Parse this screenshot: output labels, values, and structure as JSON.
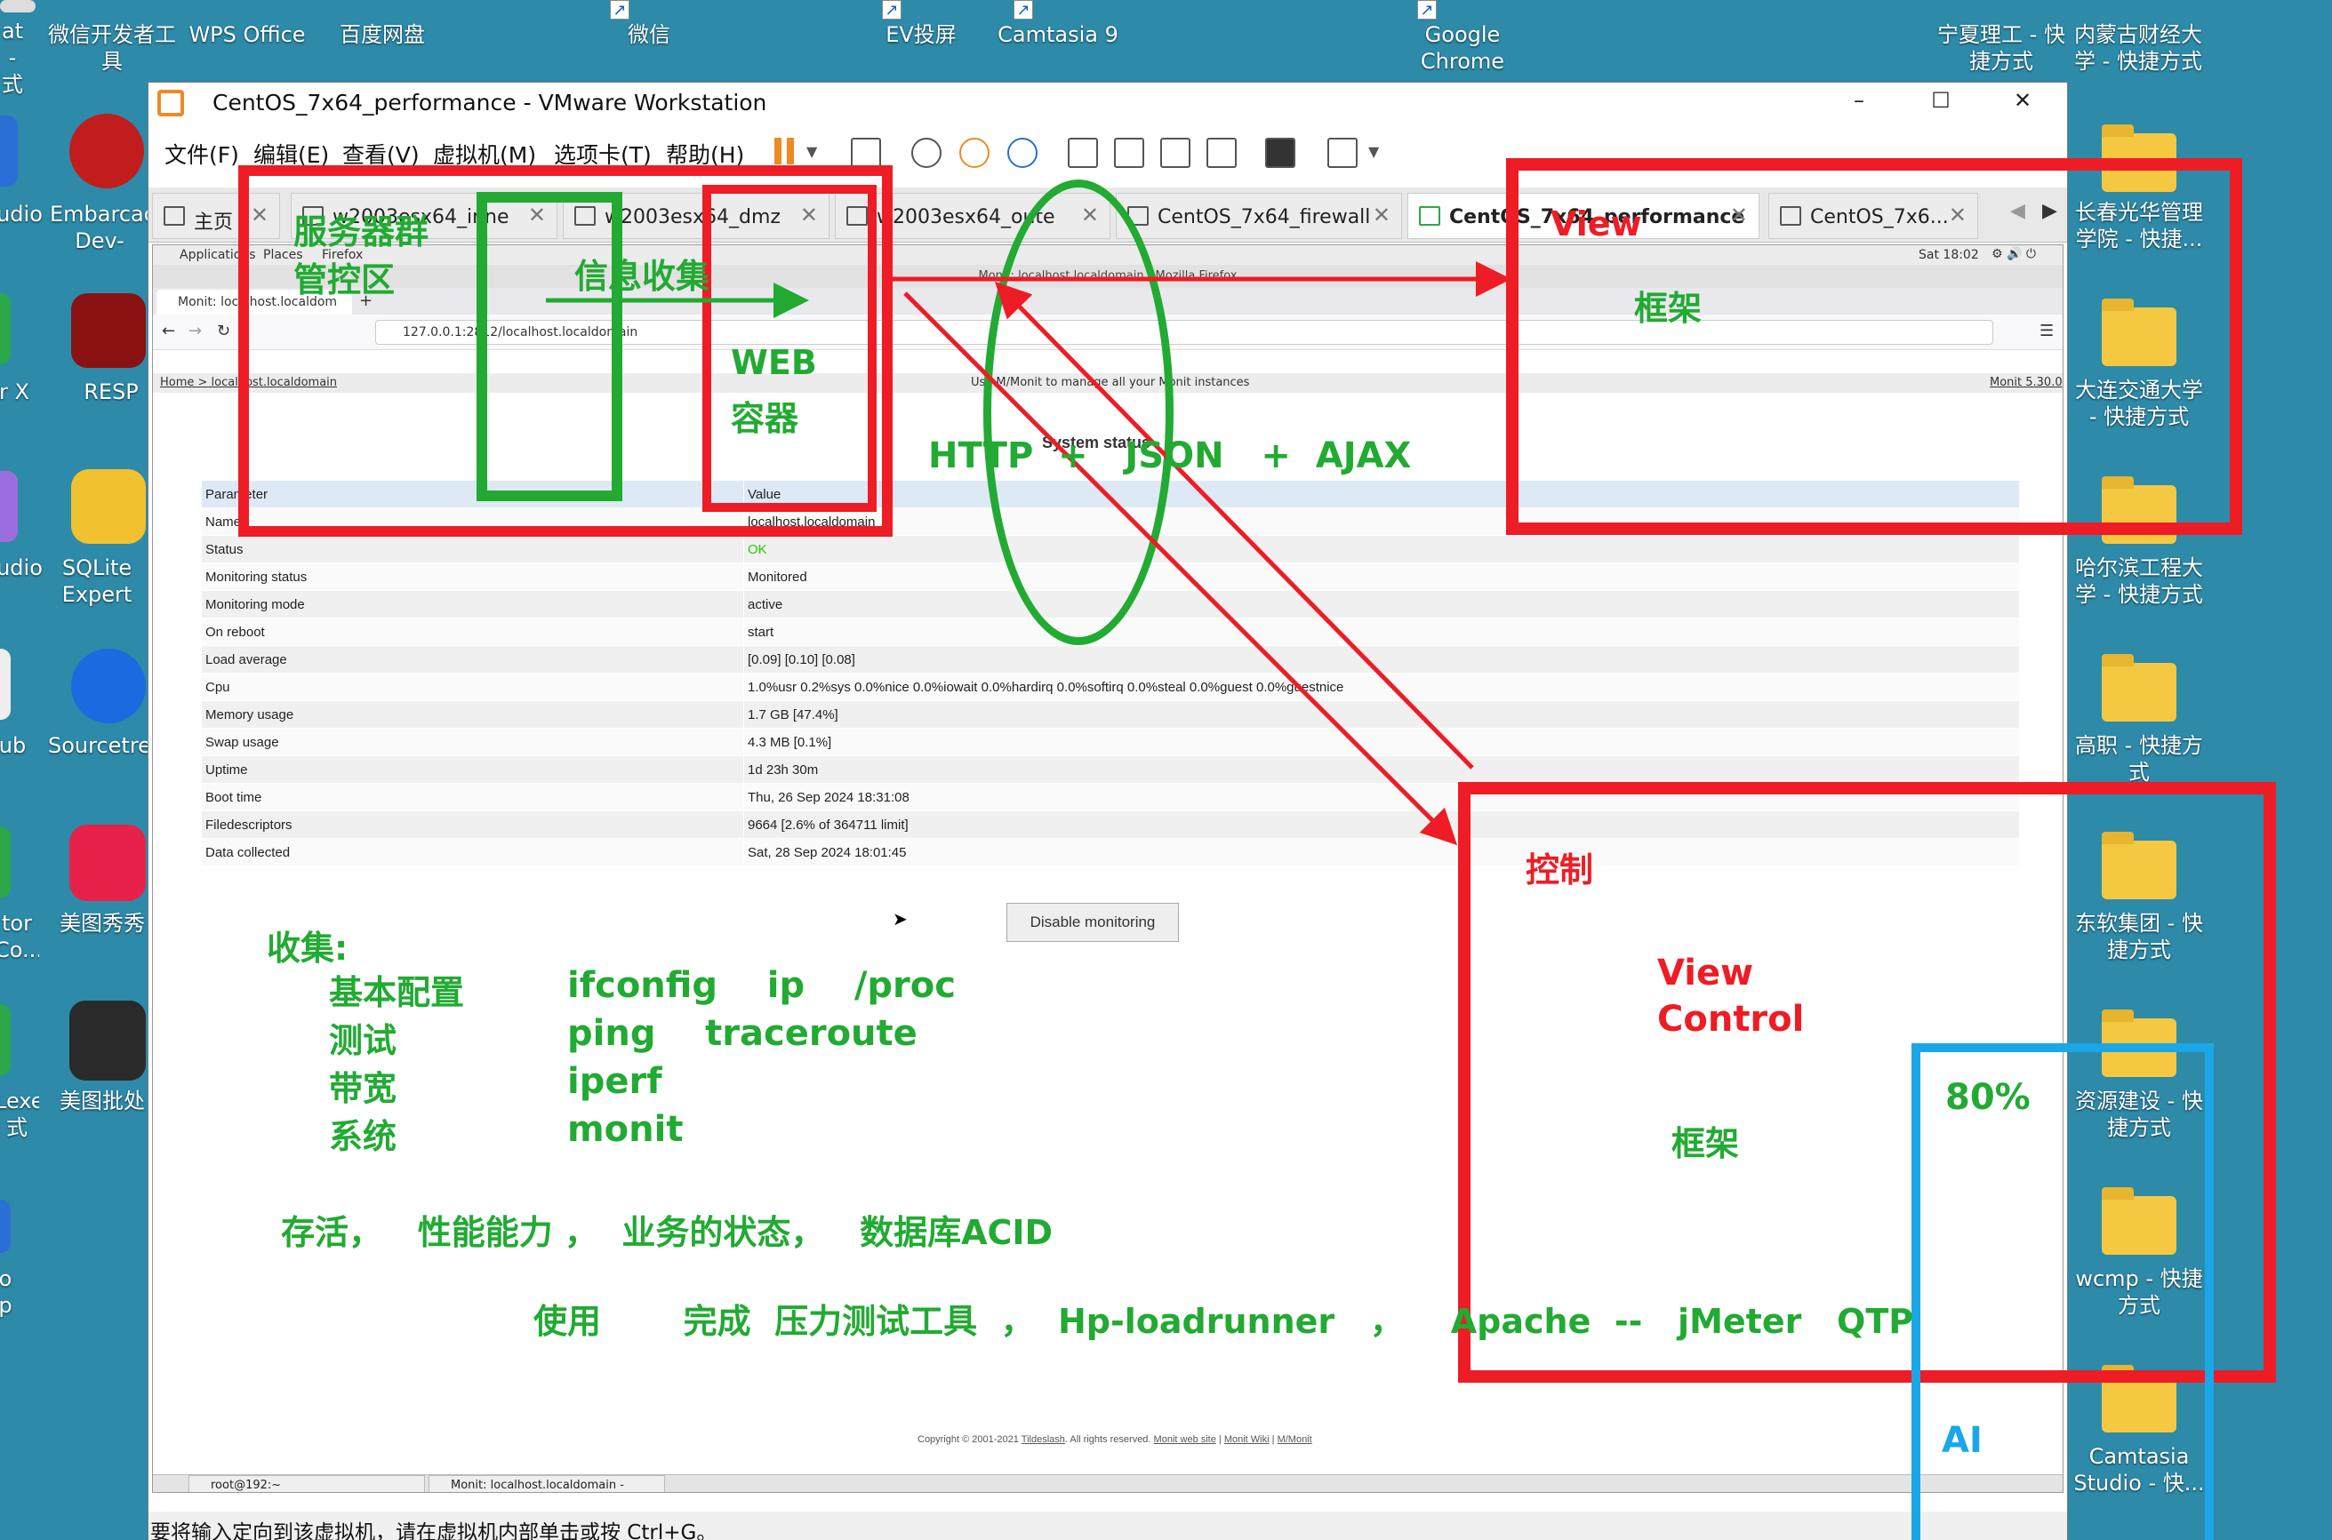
{
  "desktop": {
    "top_icons": [
      "at - 式",
      "微信开发者工具",
      "WPS Office",
      "百度网盘",
      "微信",
      "EV投屏",
      "Camtasia 9",
      "Google Chrome",
      "宁夏理工 - 快捷方式",
      "内蒙古财经大学 - 快捷方式"
    ],
    "left_icons": [
      "udio",
      "Embarcadero Dev-C++",
      "r X",
      "RESP",
      "udio",
      "SQLite Expert Pe",
      "ub",
      "Sourcetre",
      "tor Co...",
      "美图秀秀",
      "Lexe 式",
      "美图批处理",
      "o p"
    ],
    "right_icons": [
      "长春光华管理学院 - 快捷...",
      "大连交通大学 - 快捷方式",
      "哈尔滨工程大学 - 快捷方式",
      "高职 - 快捷方式",
      "东软集团 - 快捷方式",
      "资源建设 - 快捷方式",
      "wcmp - 快捷方式",
      "Camtasia Studio - 快..."
    ]
  },
  "window": {
    "title": "CentOS_7x64_performance - VMware Workstation",
    "menus": [
      "文件(F)",
      "编辑(E)",
      "查看(V)",
      "虚拟机(M)",
      "选项卡(T)",
      "帮助(H)"
    ],
    "tabs": [
      "主页",
      "w2003esx64_inne",
      "w2003esx64_dmz",
      "w2003esx64_oute",
      "CentOS_7x64_firewall",
      "CentOS_7x64_performance",
      "CentOS_7x6..."
    ],
    "status_text": "要将输入定向到该虚拟机，请在虚拟机内部单击或按 Ctrl+G。"
  },
  "guest": {
    "top_menu": [
      "Applications",
      "Places",
      "Firefox"
    ],
    "clock": "Sat 18:02",
    "ff_title": "Monit: localhost.localdomain - Mozilla Firefox",
    "ff_tab": "Monit: localhost.localdom",
    "url": "127.0.0.1:2812/localhost.localdomain",
    "breadcrumb": "Home > localhost.localdomain",
    "monit_tagline": "Use M/Monit to manage all your Monit instances",
    "monit_version": "Monit 5.30.0",
    "section_title": "System status",
    "table_header": [
      "Parameter",
      "Value"
    ],
    "rows": [
      {
        "param": "Name",
        "value": "localhost.localdomain"
      },
      {
        "param": "Status",
        "value": "OK"
      },
      {
        "param": "Monitoring status",
        "value": "Monitored"
      },
      {
        "param": "Monitoring mode",
        "value": "active"
      },
      {
        "param": "On reboot",
        "value": "start"
      },
      {
        "param": "Load average",
        "value": "[0.09] [0.10] [0.08]"
      },
      {
        "param": "Cpu",
        "value": "1.0%usr 0.2%sys 0.0%nice 0.0%iowait 0.0%hardirq 0.0%softirq 0.0%steal 0.0%guest 0.0%guestnice"
      },
      {
        "param": "Memory usage",
        "value": "1.7 GB [47.4%]"
      },
      {
        "param": "Swap usage",
        "value": "4.3 MB [0.1%]"
      },
      {
        "param": "Uptime",
        "value": "1d 23h 30m"
      },
      {
        "param": "Boot time",
        "value": "Thu, 26 Sep 2024 18:31:08"
      },
      {
        "param": "Filedescriptors",
        "value": "9664 [2.6% of 364711 limit]"
      },
      {
        "param": "Data collected",
        "value": "Sat, 28 Sep 2024 18:01:45"
      }
    ],
    "disable_button": "Disable monitoring",
    "copyright": "Copyright © 2001-2021",
    "copyright_link": "Tildeslash",
    "copyright_rest": ". All rights reserved.",
    "footer_links": [
      "Monit web site",
      "Monit Wiki",
      "M/Monit"
    ],
    "taskbar": [
      "root@192:~",
      "Monit: localhost.localdomain - Mozill..."
    ]
  },
  "annotations": {
    "server_cluster": "服务器群",
    "control_zone": "管控区",
    "info_collect": "信息收集",
    "web": "WEB",
    "container": "容器",
    "view_top": "View",
    "framework_top": "框架",
    "http_line": "HTTP  +   JSON   +  AJAX",
    "control": "控制",
    "view_control_1": "View",
    "view_control_2": "Control",
    "framework_bottom": "框架",
    "percent": "80%",
    "ai": "AI",
    "collect_title": "收集:",
    "collect_rows": [
      {
        "k": "基本配置",
        "v": "ifconfig    ip    /proc"
      },
      {
        "k": "测试",
        "v": "ping    traceroute"
      },
      {
        "k": "带宽",
        "v": "iperf"
      },
      {
        "k": "系统",
        "v": "monit"
      }
    ],
    "alive_line": "存活，   性能能力 ，  业务的状态，   数据库ACID",
    "usage_line": "使用       完成  压力测试工具  ，  Hp-loadrunner   ，    Apache  --   jMeter   QTP"
  },
  "colors": {
    "annotation_red": "#ee1c25",
    "annotation_green": "#22aa33",
    "annotation_blue": "#1aa7e8",
    "desktop_bg": "#2d8aa8"
  }
}
